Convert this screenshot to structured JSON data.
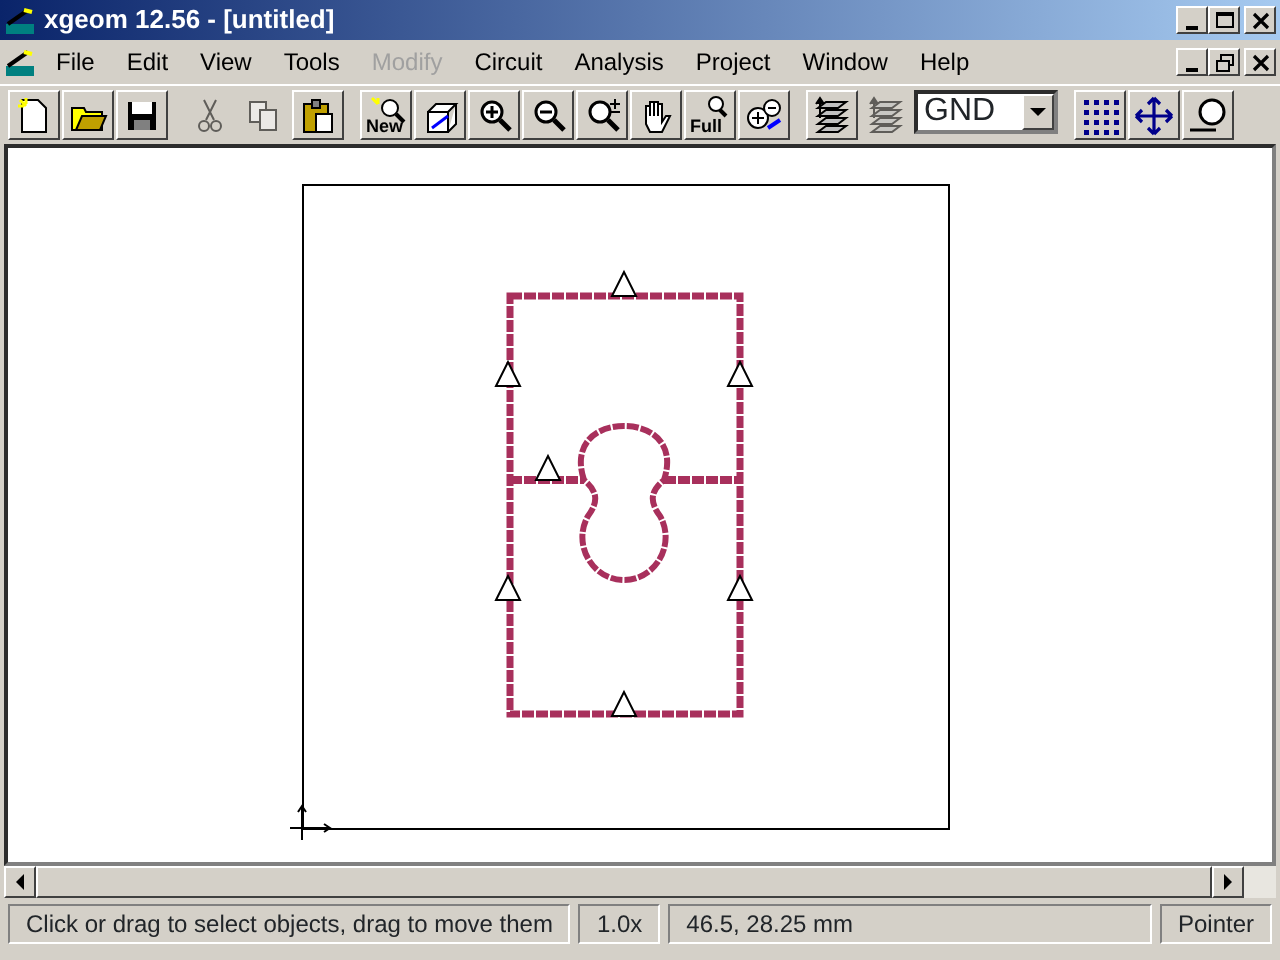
{
  "window": {
    "title": "xgeom 12.56 - [untitled]"
  },
  "menu": [
    {
      "label": "File",
      "disabled": false
    },
    {
      "label": "Edit",
      "disabled": false
    },
    {
      "label": "View",
      "disabled": false
    },
    {
      "label": "Tools",
      "disabled": false
    },
    {
      "label": "Modify",
      "disabled": true
    },
    {
      "label": "Circuit",
      "disabled": false
    },
    {
      "label": "Analysis",
      "disabled": false
    },
    {
      "label": "Project",
      "disabled": false
    },
    {
      "label": "Window",
      "disabled": false
    },
    {
      "label": "Help",
      "disabled": false
    }
  ],
  "toolbar": [
    [
      {
        "kind": "new",
        "disabled": false
      },
      {
        "kind": "open",
        "disabled": false
      },
      {
        "kind": "save",
        "disabled": false
      }
    ],
    [
      {
        "kind": "cut",
        "disabled": true
      },
      {
        "kind": "copy",
        "disabled": true
      },
      {
        "kind": "paste",
        "disabled": false
      }
    ],
    [
      {
        "kind": "newview",
        "label": "New",
        "disabled": false
      },
      {
        "kind": "cube",
        "disabled": false
      },
      {
        "kind": "zoomin",
        "disabled": false
      },
      {
        "kind": "zoomout",
        "disabled": false
      },
      {
        "kind": "zoomstep",
        "disabled": false
      },
      {
        "kind": "hand",
        "disabled": false
      },
      {
        "kind": "full",
        "label": "Full",
        "disabled": false
      },
      {
        "kind": "zoomswap",
        "disabled": false
      }
    ],
    [
      {
        "kind": "layers",
        "disabled": false
      },
      {
        "kind": "layers",
        "disabled": true
      },
      {
        "kind": "select",
        "value": "GND"
      }
    ],
    [
      {
        "kind": "grid",
        "disabled": false
      },
      {
        "kind": "move",
        "disabled": false
      },
      {
        "kind": "measure",
        "disabled": false
      }
    ]
  ],
  "status_bar": [
    "Click or drag to select objects, drag to move them",
    "1.0x",
    "46.5, 28.25 mm",
    "Pointer"
  ]
}
